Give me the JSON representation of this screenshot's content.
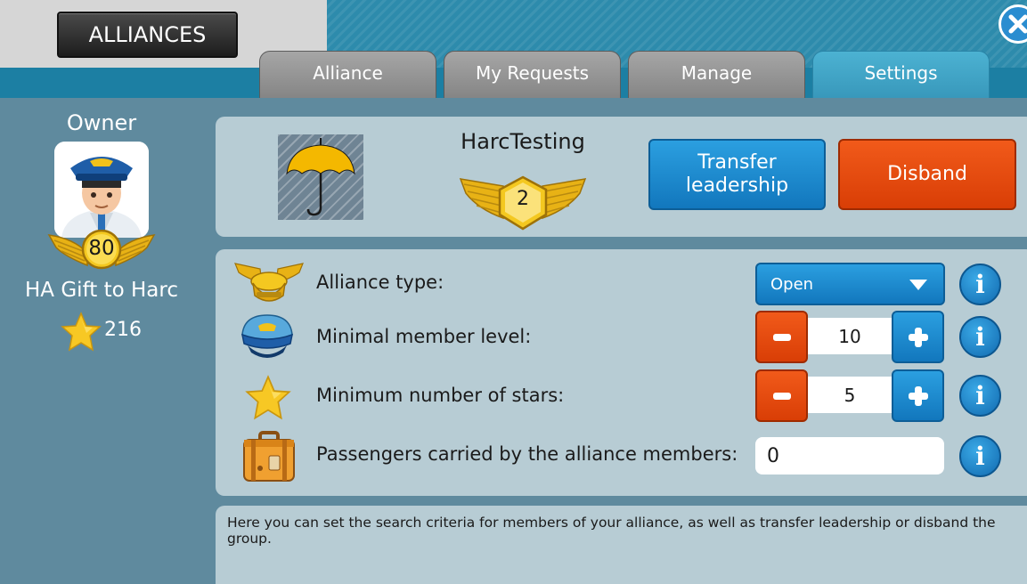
{
  "header": {
    "title": "ALLIANCES",
    "close_icon": "close-icon",
    "tabs": [
      {
        "label": "Alliance",
        "active": false
      },
      {
        "label": "My Requests",
        "active": false
      },
      {
        "label": "Manage",
        "active": false
      },
      {
        "label": "Settings",
        "active": true
      }
    ]
  },
  "owner": {
    "title": "Owner",
    "avatar_icon": "pilot-avatar-icon",
    "level": "80",
    "name": "HA Gift to Harc",
    "stars": "216"
  },
  "alliance": {
    "emblem_icon": "umbrella-icon",
    "name": "HarcTesting",
    "level": "2",
    "transfer_label": "Transfer leadership",
    "disband_label": "Disband"
  },
  "settings": {
    "type": {
      "label": "Alliance type:",
      "value": "Open",
      "icon": "alliance-cap-icon"
    },
    "min_level": {
      "label": "Minimal member level:",
      "value": "10",
      "icon": "pilot-cap-icon"
    },
    "min_stars": {
      "label": "Minimum number of stars:",
      "value": "5",
      "icon": "star-icon"
    },
    "passengers": {
      "label": "Passengers carried by the alliance members:",
      "value": "0",
      "icon": "suitcase-icon"
    },
    "info_label": "i"
  },
  "help_text": "Here you can set the search criteria for members of your alliance, as well as transfer leadership or disband the group.",
  "colors": {
    "accent_blue": "#1c7fa3",
    "button_blue": "#1f8ad0",
    "button_orange": "#e4470d",
    "panel": "#b7ccd4",
    "background": "#5f8a9e",
    "gold": "#f2c21a"
  }
}
